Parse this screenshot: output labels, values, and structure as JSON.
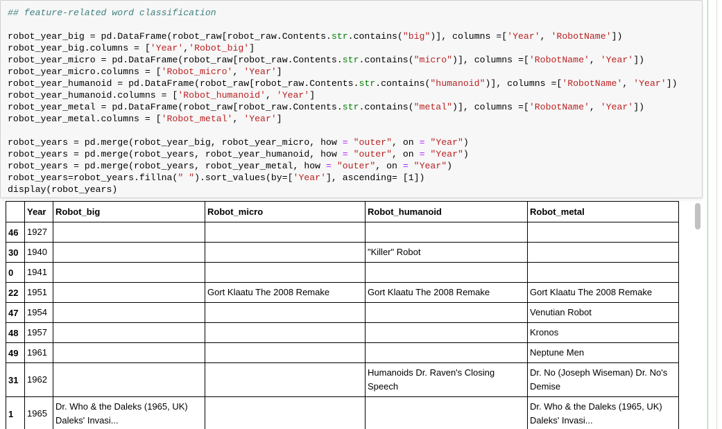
{
  "code_cell": {
    "lines": [
      [
        {
          "t": "## feature-related word classification",
          "c": "comment"
        }
      ],
      [
        {
          "t": "",
          "c": ""
        }
      ],
      [
        {
          "t": "robot_year_big = pd.DataFrame(robot_raw[robot_raw.Contents.",
          "c": ""
        },
        {
          "t": "str",
          "c": "builtin"
        },
        {
          "t": ".contains(",
          "c": ""
        },
        {
          "t": "\"big\"",
          "c": "str"
        },
        {
          "t": ")], columns =[",
          "c": ""
        },
        {
          "t": "'Year'",
          "c": "str"
        },
        {
          "t": ", ",
          "c": ""
        },
        {
          "t": "'RobotName'",
          "c": "str"
        },
        {
          "t": "])",
          "c": ""
        }
      ],
      [
        {
          "t": "robot_year_big.columns = [",
          "c": ""
        },
        {
          "t": "'Year'",
          "c": "str"
        },
        {
          "t": ",",
          "c": ""
        },
        {
          "t": "'Robot_big'",
          "c": "str"
        },
        {
          "t": "]",
          "c": ""
        }
      ],
      [
        {
          "t": "robot_year_micro = pd.DataFrame(robot_raw[robot_raw.Contents.",
          "c": ""
        },
        {
          "t": "str",
          "c": "builtin"
        },
        {
          "t": ".contains(",
          "c": ""
        },
        {
          "t": "\"micro\"",
          "c": "str"
        },
        {
          "t": ")], columns =[",
          "c": ""
        },
        {
          "t": "'RobotName'",
          "c": "str"
        },
        {
          "t": ", ",
          "c": ""
        },
        {
          "t": "'Year'",
          "c": "str"
        },
        {
          "t": "])",
          "c": ""
        }
      ],
      [
        {
          "t": "robot_year_micro.columns = [",
          "c": ""
        },
        {
          "t": "'Robot_micro'",
          "c": "str"
        },
        {
          "t": ", ",
          "c": ""
        },
        {
          "t": "'Year'",
          "c": "str"
        },
        {
          "t": "]",
          "c": ""
        }
      ],
      [
        {
          "t": "robot_year_humanoid = pd.DataFrame(robot_raw[robot_raw.Contents.",
          "c": ""
        },
        {
          "t": "str",
          "c": "builtin"
        },
        {
          "t": ".contains(",
          "c": ""
        },
        {
          "t": "\"humanoid\"",
          "c": "str"
        },
        {
          "t": ")], columns =[",
          "c": ""
        },
        {
          "t": "'RobotName'",
          "c": "str"
        },
        {
          "t": ", ",
          "c": ""
        },
        {
          "t": "'Year'",
          "c": "str"
        },
        {
          "t": "])",
          "c": ""
        }
      ],
      [
        {
          "t": "robot_year_humanoid.columns = [",
          "c": ""
        },
        {
          "t": "'Robot_humanoid'",
          "c": "str"
        },
        {
          "t": ", ",
          "c": ""
        },
        {
          "t": "'Year'",
          "c": "str"
        },
        {
          "t": "]",
          "c": ""
        }
      ],
      [
        {
          "t": "robot_year_metal = pd.DataFrame(robot_raw[robot_raw.Contents.",
          "c": ""
        },
        {
          "t": "str",
          "c": "builtin"
        },
        {
          "t": ".contains(",
          "c": ""
        },
        {
          "t": "\"metal\"",
          "c": "str"
        },
        {
          "t": ")], columns =[",
          "c": ""
        },
        {
          "t": "'RobotName'",
          "c": "str"
        },
        {
          "t": ", ",
          "c": ""
        },
        {
          "t": "'Year'",
          "c": "str"
        },
        {
          "t": "])",
          "c": ""
        }
      ],
      [
        {
          "t": "robot_year_metal.columns = [",
          "c": ""
        },
        {
          "t": "'Robot_metal'",
          "c": "str"
        },
        {
          "t": ", ",
          "c": ""
        },
        {
          "t": "'Year'",
          "c": "str"
        },
        {
          "t": "]",
          "c": ""
        }
      ],
      [
        {
          "t": "",
          "c": ""
        }
      ],
      [
        {
          "t": "robot_years = pd.merge(robot_year_big, robot_year_micro, how ",
          "c": ""
        },
        {
          "t": "=",
          "c": "eq"
        },
        {
          "t": " ",
          "c": ""
        },
        {
          "t": "\"outer\"",
          "c": "str"
        },
        {
          "t": ", on ",
          "c": ""
        },
        {
          "t": "=",
          "c": "eq"
        },
        {
          "t": " ",
          "c": ""
        },
        {
          "t": "\"Year\"",
          "c": "str"
        },
        {
          "t": ")",
          "c": ""
        }
      ],
      [
        {
          "t": "robot_years = pd.merge(robot_years, robot_year_humanoid, how ",
          "c": ""
        },
        {
          "t": "=",
          "c": "eq"
        },
        {
          "t": " ",
          "c": ""
        },
        {
          "t": "\"outer\"",
          "c": "str"
        },
        {
          "t": ", on ",
          "c": ""
        },
        {
          "t": "=",
          "c": "eq"
        },
        {
          "t": " ",
          "c": ""
        },
        {
          "t": "\"Year\"",
          "c": "str"
        },
        {
          "t": ")",
          "c": ""
        }
      ],
      [
        {
          "t": "robot_years = pd.merge(robot_years, robot_year_metal, how ",
          "c": ""
        },
        {
          "t": "=",
          "c": "eq"
        },
        {
          "t": " ",
          "c": ""
        },
        {
          "t": "\"outer\"",
          "c": "str"
        },
        {
          "t": ", on ",
          "c": ""
        },
        {
          "t": "=",
          "c": "eq"
        },
        {
          "t": " ",
          "c": ""
        },
        {
          "t": "\"Year\"",
          "c": "str"
        },
        {
          "t": ")",
          "c": ""
        }
      ],
      [
        {
          "t": "robot_years=robot_years.fillna(",
          "c": ""
        },
        {
          "t": "\" \"",
          "c": "str"
        },
        {
          "t": ").sort_values(by=[",
          "c": ""
        },
        {
          "t": "'Year'",
          "c": "str"
        },
        {
          "t": "], ascending= [1])",
          "c": ""
        }
      ],
      [
        {
          "t": "display(robot_years)",
          "c": ""
        }
      ]
    ]
  },
  "table": {
    "columns": [
      "",
      "Year",
      "Robot_big",
      "Robot_micro",
      "Robot_humanoid",
      "Robot_metal"
    ],
    "rows": [
      {
        "index": "46",
        "year": "1927",
        "big": "",
        "micro": "",
        "humanoid": "",
        "metal": ""
      },
      {
        "index": "30",
        "year": "1940",
        "big": "",
        "micro": "",
        "humanoid": "\"Killer\" Robot",
        "metal": ""
      },
      {
        "index": "0",
        "year": "1941",
        "big": "",
        "micro": "",
        "humanoid": "",
        "metal": ""
      },
      {
        "index": "22",
        "year": "1951",
        "big": "",
        "micro": "Gort Klaatu The 2008 Remake",
        "humanoid": "Gort Klaatu The 2008 Remake",
        "metal": "Gort Klaatu The 2008 Remake"
      },
      {
        "index": "47",
        "year": "1954",
        "big": "",
        "micro": "",
        "humanoid": "",
        "metal": "Venutian Robot"
      },
      {
        "index": "48",
        "year": "1957",
        "big": "",
        "micro": "",
        "humanoid": "",
        "metal": "Kronos"
      },
      {
        "index": "49",
        "year": "1961",
        "big": "",
        "micro": "",
        "humanoid": "",
        "metal": "Neptune Men"
      },
      {
        "index": "31",
        "year": "1962",
        "big": "",
        "micro": "",
        "humanoid": "Humanoids Dr. Raven's Closing Speech",
        "metal": "Dr. No (Joseph Wiseman) Dr. No's Demise"
      },
      {
        "index": "1",
        "year": "1965",
        "big": "Dr. Who & the Daleks (1965, UK) Daleks' Invasi...",
        "micro": "",
        "humanoid": "",
        "metal": "Dr. Who & the Daleks (1965, UK) Daleks' Invasi..."
      }
    ]
  },
  "colors": {
    "comment": "#408080",
    "string": "#ba2121",
    "operator": "#aa22ff",
    "builtin": "#008000",
    "cell_background": "#f7f7f7"
  }
}
